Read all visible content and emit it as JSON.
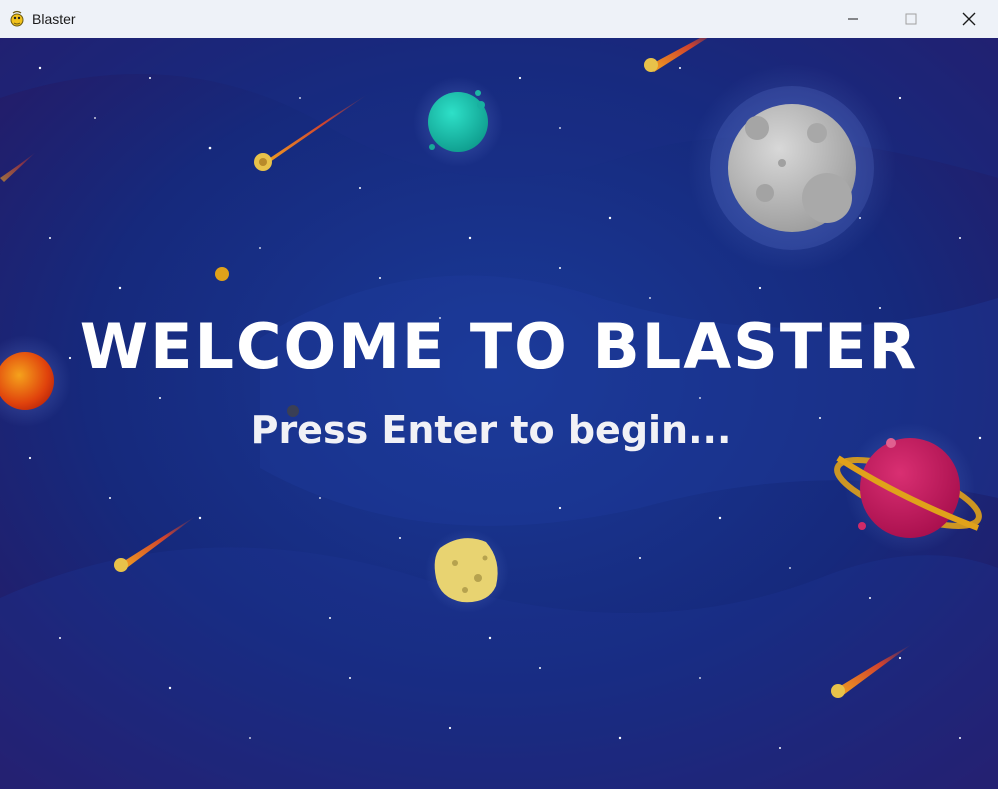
{
  "window": {
    "title": "Blaster",
    "app_icon": "pygame-snake-icon",
    "controls": {
      "minimize_icon": "minimize-icon",
      "maximize_icon": "maximize-icon",
      "close_icon": "close-icon"
    }
  },
  "game": {
    "headline": "WELCOME TO BLASTER",
    "prompt": "Press Enter to begin...",
    "colors": {
      "background": "#142a7a",
      "text": "#ffffff",
      "moon": "#bdbdbd",
      "teal_planet": "#1fc3b0",
      "pink_planet": "#c8155a",
      "ring": "#e0a21a",
      "asteroid": "#e8d371",
      "red_planet": "#e0420c",
      "meteor_tail": "#ff5a1a"
    }
  }
}
